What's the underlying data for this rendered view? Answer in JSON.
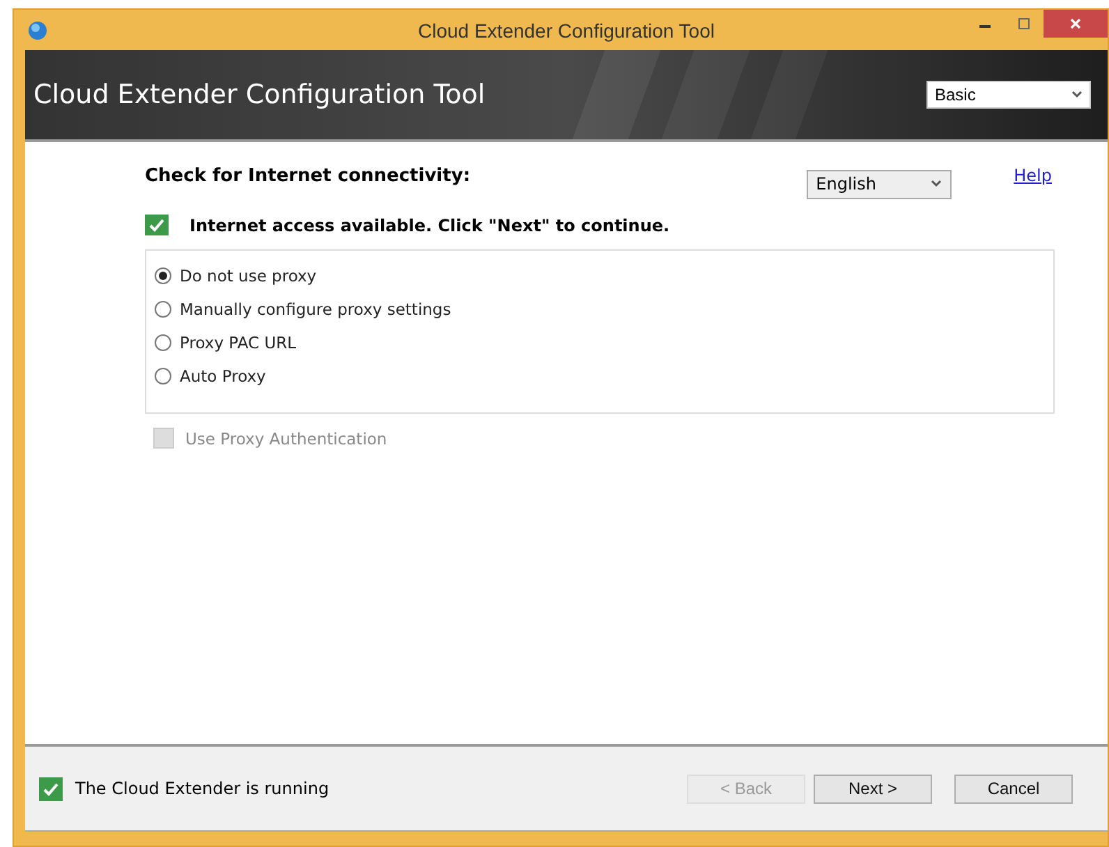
{
  "window": {
    "title": "Cloud Extender Configuration Tool"
  },
  "header": {
    "title": "Cloud Extender Configuration Tool",
    "mode": "Basic"
  },
  "heading": "Check for Internet connectivity:",
  "language": "English",
  "help_link": "Help",
  "status_message": {
    "text": "Internet access available. Click \"Next\" to continue.",
    "ok": true
  },
  "proxy_options": [
    {
      "label": "Do not use proxy",
      "selected": true
    },
    {
      "label": "Manually configure proxy settings",
      "selected": false
    },
    {
      "label": "Proxy PAC URL",
      "selected": false
    },
    {
      "label": "Auto Proxy",
      "selected": false
    }
  ],
  "proxy_auth": {
    "label": "Use Proxy Authentication",
    "checked": false,
    "disabled": true
  },
  "footer": {
    "status": "The Cloud Extender is running",
    "ok": true
  },
  "buttons": [
    {
      "label": "< Back",
      "disabled": true
    },
    {
      "label": "Next >",
      "disabled": false
    },
    {
      "label": "Cancel",
      "disabled": false
    }
  ]
}
